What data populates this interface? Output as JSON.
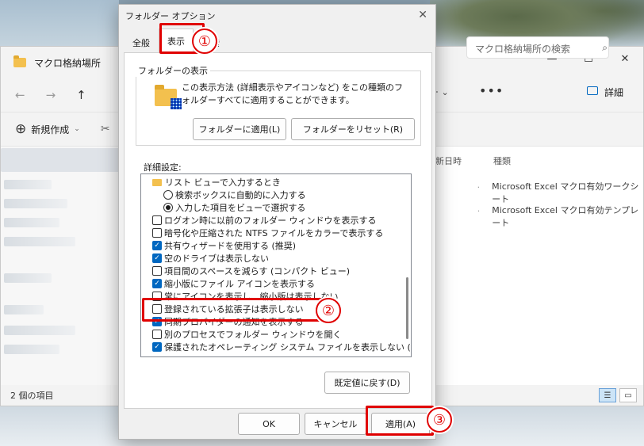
{
  "explorer": {
    "title": "マクロ格納場所",
    "search_placeholder": "マクロ格納場所の検索",
    "new_label": "新規作成",
    "details_label": "詳細",
    "more_icon": "more-icon",
    "col_date": "新日時",
    "col_type": "種類",
    "files": [
      {
        "date": ".",
        "type": "Microsoft Excel マクロ有効ワークシート"
      },
      {
        "date": ".",
        "type": "Microsoft Excel マクロ有効テンプレート"
      }
    ],
    "status": "2 個の項目"
  },
  "dialog": {
    "title": "フォルダー オプション",
    "tabs": [
      "全般",
      "表示",
      "検索"
    ],
    "folder_view": {
      "label": "フォルダーの表示",
      "description": "この表示方法 (詳細表示やアイコンなど) をこの種類のフォルダーすべてに適用することができます。",
      "apply_button": "フォルダーに適用(L)",
      "reset_button": "フォルダーをリセット(R)"
    },
    "advanced": {
      "label": "詳細設定:",
      "items": [
        {
          "kind": "folder",
          "label": "リスト ビューで入力するとき",
          "indent": 0
        },
        {
          "kind": "radio",
          "checked": false,
          "label": "検索ボックスに自動的に入力する",
          "indent": 1
        },
        {
          "kind": "radio",
          "checked": true,
          "label": "入力した項目をビューで選択する",
          "indent": 1
        },
        {
          "kind": "checkbox",
          "checked": false,
          "label": "ログオン時に以前のフォルダー ウィンドウを表示する",
          "indent": 0
        },
        {
          "kind": "checkbox",
          "checked": false,
          "label": "暗号化や圧縮された NTFS ファイルをカラーで表示する",
          "indent": 0
        },
        {
          "kind": "checkbox",
          "checked": true,
          "label": "共有ウィザードを使用する (推奨)",
          "indent": 0
        },
        {
          "kind": "checkbox",
          "checked": true,
          "label": "空のドライブは表示しない",
          "indent": 0
        },
        {
          "kind": "checkbox",
          "checked": false,
          "label": "項目間のスペースを減らす (コンパクト ビュー)",
          "indent": 0
        },
        {
          "kind": "checkbox",
          "checked": true,
          "label": "縮小版にファイル アイコンを表示する",
          "indent": 0
        },
        {
          "kind": "checkbox",
          "checked": false,
          "label": "常にアイコンを表示し、縮小版は表示しない",
          "indent": 0
        },
        {
          "kind": "checkbox",
          "checked": false,
          "label": "登録されている拡張子は表示しない",
          "indent": 0
        },
        {
          "kind": "checkbox",
          "checked": true,
          "label": "同期プロバイダーの通知を表示する",
          "indent": 0
        },
        {
          "kind": "checkbox",
          "checked": false,
          "label": "別のプロセスでフォルダー ウィンドウを開く",
          "indent": 0
        },
        {
          "kind": "checkbox",
          "checked": true,
          "label": "保護されたオペレーティング システム ファイルを表示しない (推奨)",
          "indent": 0
        }
      ],
      "restore_button": "既定値に戻す(D)"
    },
    "ok_button": "OK",
    "cancel_button": "キャンセル",
    "apply_button": "適用(A)"
  },
  "annotations": {
    "step1": "①",
    "step2": "②",
    "step3": "③",
    "color": "#e00000"
  }
}
